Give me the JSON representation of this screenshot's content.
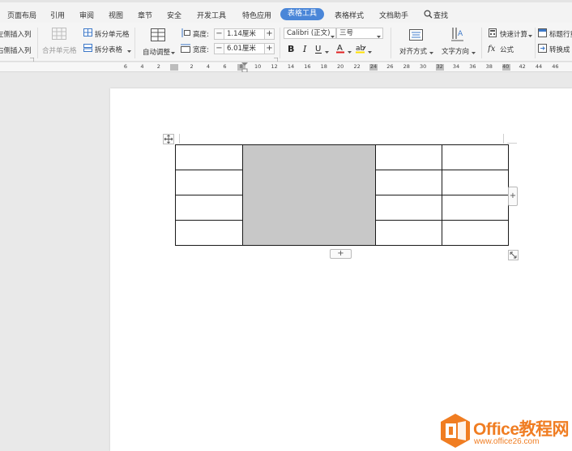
{
  "menu": {
    "items": [
      "页面布局",
      "引用",
      "审阅",
      "视图",
      "章节",
      "安全",
      "开发工具",
      "特色应用"
    ],
    "active": "表格工具",
    "after": [
      "表格样式",
      "文档助手"
    ],
    "search": "查找"
  },
  "ribbon": {
    "insert_left": "左侧插入列",
    "insert_right": "右侧插入列",
    "merge_cells": "合并单元格",
    "split_cells": "拆分单元格",
    "split_table": "拆分表格",
    "autofit": "自动调整",
    "height_label": "高度:",
    "height_value": "1.14厘米",
    "width_label": "宽度:",
    "width_value": "6.01厘米",
    "font_name": "Calibri (正文)",
    "font_size": "三号",
    "align": "对齐方式",
    "text_direction": "文字方向",
    "quick_calc": "快速计算",
    "formula": "公式",
    "title_row_repeat": "标题行重",
    "convert": "转换成"
  },
  "ruler": {
    "labels": [
      "6",
      "4",
      "2",
      "",
      "2",
      "4",
      "6",
      "8",
      "10",
      "12",
      "14",
      "16",
      "18",
      "20",
      "22",
      "24",
      "26",
      "28",
      "30",
      "32",
      "34",
      "36",
      "38",
      "40",
      "42",
      "44",
      "46"
    ]
  },
  "table": {
    "rows": 4,
    "cols": 4,
    "merged_column": 2
  },
  "watermark": {
    "title": "Office教程网",
    "url": "www.office26.com"
  },
  "colors": {
    "accent": "#4a86d8",
    "merged_fill": "#c8c8c8",
    "watermark": "#f07d22"
  }
}
